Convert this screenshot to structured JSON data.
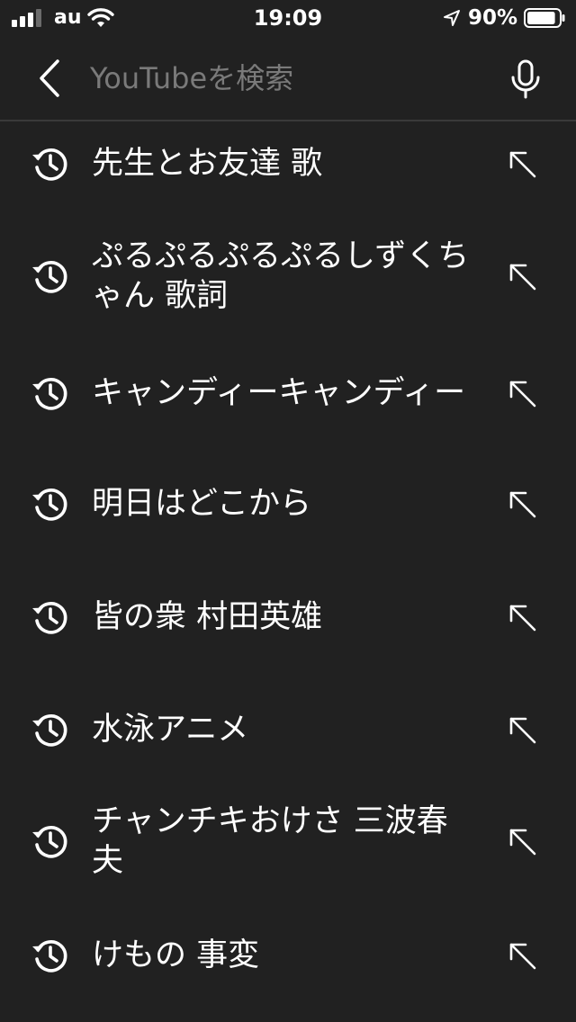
{
  "status_bar": {
    "carrier": "au",
    "time": "19:09",
    "battery_percent": "90%",
    "battery_level": 0.9,
    "signal_bars_active": 3,
    "signal_bars_total": 4
  },
  "search": {
    "placeholder": "YouTubeを検索",
    "value": ""
  },
  "icons": {
    "back": "chevron-left-icon",
    "mic": "microphone-icon",
    "history": "history-icon",
    "fill": "arrow-up-left-icon"
  },
  "colors": {
    "background": "#212121",
    "text": "#ffffff",
    "placeholder": "#7a7a7a",
    "divider": "#3a3a3a"
  },
  "suggestions": [
    {
      "text": "先生とお友達 歌"
    },
    {
      "text": "ぷるぷるぷるぷるしずくちゃん 歌詞"
    },
    {
      "text": "キャンディーキャンディー"
    },
    {
      "text": "明日はどこから"
    },
    {
      "text": "皆の衆 村田英雄"
    },
    {
      "text": "水泳アニメ"
    },
    {
      "text": "チャンチキおけさ 三波春夫"
    },
    {
      "text": "けもの 事変"
    }
  ]
}
